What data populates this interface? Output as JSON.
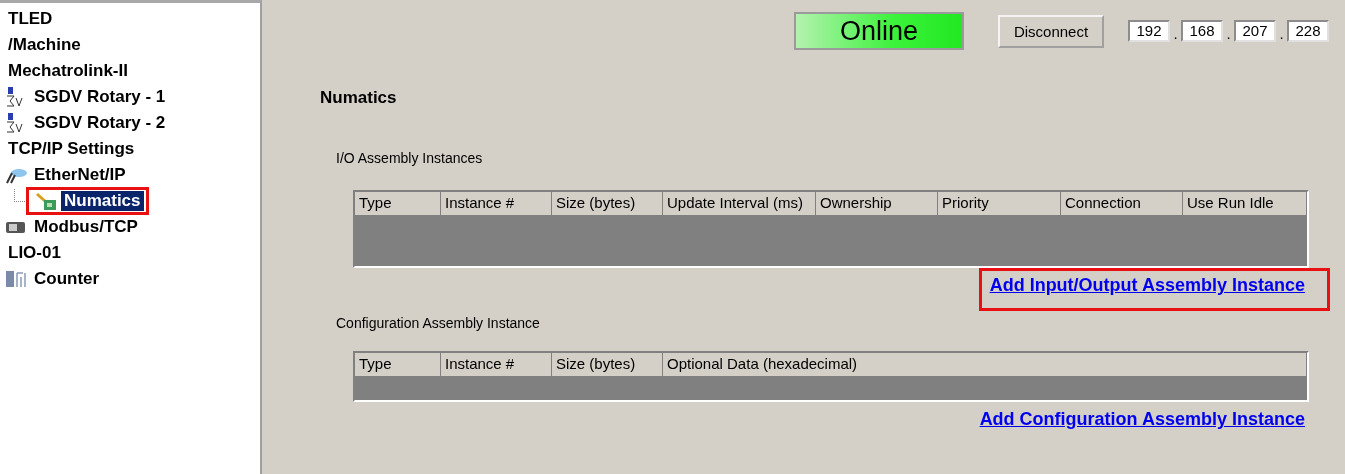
{
  "tree": [
    {
      "label": "TLED",
      "kind": "text",
      "selected": false,
      "highlighted": false
    },
    {
      "label": "/Machine",
      "kind": "text",
      "selected": false,
      "highlighted": false
    },
    {
      "label": "Mechatrolink-II",
      "kind": "text",
      "selected": false,
      "highlighted": false
    },
    {
      "label": "SGDV Rotary - 1",
      "kind": "servo",
      "selected": false,
      "highlighted": false
    },
    {
      "label": "SGDV Rotary - 2",
      "kind": "servo",
      "selected": false,
      "highlighted": false
    },
    {
      "label": "TCP/IP Settings",
      "kind": "text",
      "selected": false,
      "highlighted": false
    },
    {
      "label": "EtherNet/IP",
      "kind": "ethernet",
      "selected": false,
      "highlighted": false,
      "children": [
        {
          "label": "Numatics",
          "kind": "device",
          "selected": true,
          "highlighted": true
        }
      ]
    },
    {
      "label": "Modbus/TCP",
      "kind": "modbus",
      "selected": false,
      "highlighted": false
    },
    {
      "label": "LIO-01",
      "kind": "text",
      "selected": false,
      "highlighted": false
    },
    {
      "label": "Counter",
      "kind": "counter",
      "selected": false,
      "highlighted": false
    }
  ],
  "status": {
    "label": "Online",
    "kind": "online"
  },
  "disconnect_button": "Disconnect",
  "ip_octets": [
    "192",
    "168",
    "207",
    "228"
  ],
  "ip_separators": [
    ".",
    ".",
    "."
  ],
  "title": "Numatics",
  "io_section": {
    "label": "I/O Assembly Instances",
    "columns": [
      "Type",
      "Instance #",
      "Size (bytes)",
      "Update Interval (ms)",
      "Ownership",
      "Priority",
      "Connection",
      "Use Run Idle"
    ],
    "link": {
      "text": "Add Input/Output Assembly Instance",
      "highlighted": true
    }
  },
  "config_section": {
    "label": "Configuration Assembly Instance",
    "columns": [
      "Type",
      "Instance #",
      "Size (bytes)",
      "Optional Data (hexadecimal)"
    ],
    "link": {
      "text": "Add Configuration Assembly Instance",
      "highlighted": false
    }
  }
}
